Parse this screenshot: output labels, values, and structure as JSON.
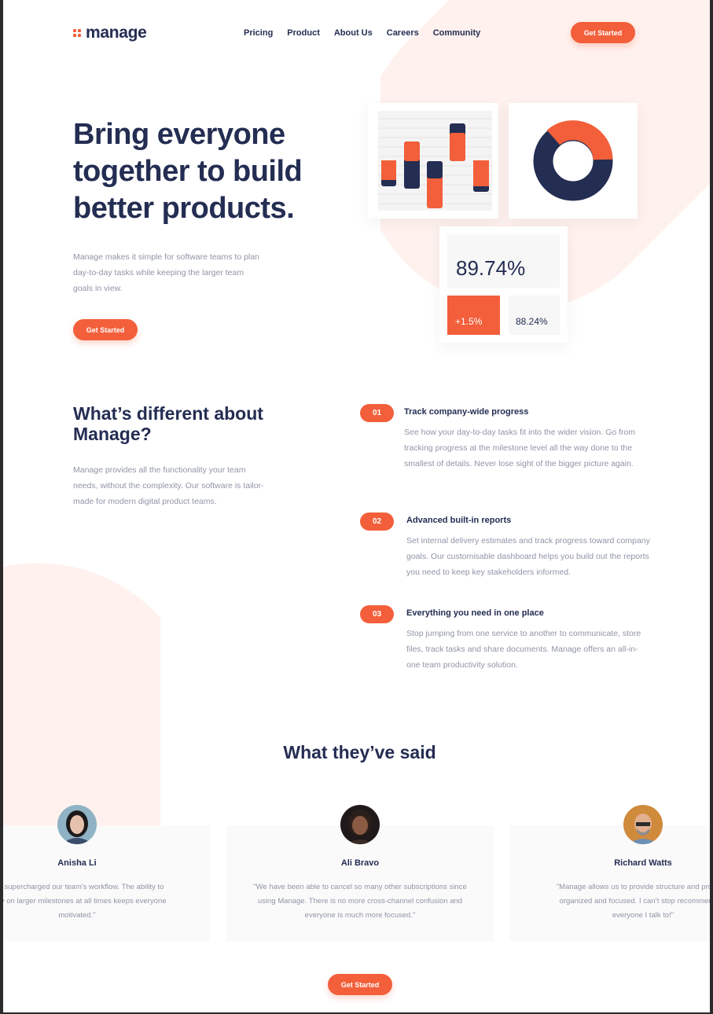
{
  "header": {
    "logo_text": "manage",
    "nav": [
      "Pricing",
      "Product",
      "About Us",
      "Careers",
      "Community"
    ],
    "cta": "Get Started"
  },
  "hero": {
    "title": "Bring everyone together to build better products.",
    "description": "Manage makes it simple for software teams to plan day-to-day tasks while keeping the larger team goals in view.",
    "cta": "Get Started"
  },
  "dashboard": {
    "main_stat": "89.74%",
    "stat_a": "+1.5%",
    "stat_b": "88.24%"
  },
  "features_section": {
    "title": "What’s different about Manage?",
    "description": "Manage provides all the functionality your team needs, without the complexity. Our software is tailor-made for modern digital product teams.",
    "items": [
      {
        "number": "01",
        "title": "Track company-wide progress",
        "description": "See how your day-to-day tasks fit into the wider vision. Go from tracking progress at the milestone level all the way done to the smallest of details. Never lose sight of the bigger picture again."
      },
      {
        "number": "02",
        "title": "Advanced built-in reports",
        "description": "Set internal delivery estimates and track progress toward company goals. Our customisable dashboard helps you build out the reports you need to keep key stakeholders informed."
      },
      {
        "number": "03",
        "title": "Everything you need in one place",
        "description": "Stop jumping from one service to another to communicate, store files, track tasks and share documents. Manage offers an all-in-one team productivity solution."
      }
    ]
  },
  "testimonials": {
    "title": "What they’ve said",
    "items": [
      {
        "name": "Anisha Li",
        "quote_lines": [
          "has supercharged our team’s workflow. The ability to",
          "ibility on larger milestones at all times keeps everyone",
          "motivated.\""
        ]
      },
      {
        "name": "Ali Bravo",
        "quote_lines": [
          "\"We have been able to cancel so many other subscriptions since",
          "using Manage. There is no more cross-channel confusion and",
          "everyone is much more focused.\""
        ]
      },
      {
        "name": "Richard Watts",
        "quote_lines": [
          "\"Manage allows us to provide structure and process.",
          "organized and focused. I can’t stop recommending",
          "everyone I talk to!\""
        ]
      }
    ]
  },
  "footer_cta": "Get Started",
  "colors": {
    "accent": "#f25f3a",
    "navy": "#242d52",
    "muted": "#9095a7",
    "tint": "#fff1ed"
  }
}
